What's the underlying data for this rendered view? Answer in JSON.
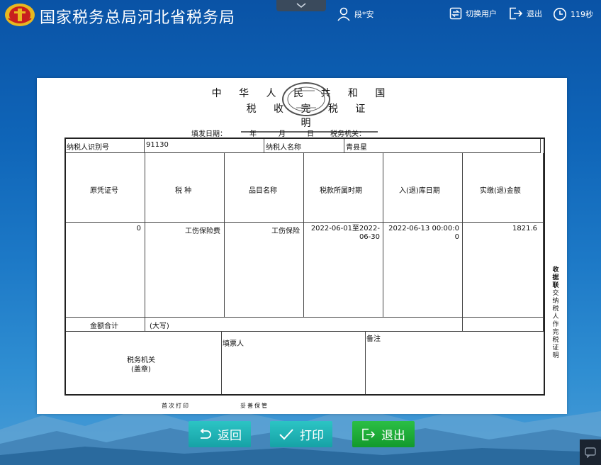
{
  "header": {
    "title": "国家税务总局河北省税务局",
    "user": "段*安",
    "switch_user": "切换用户",
    "logout": "退出",
    "countdown": "119秒"
  },
  "document": {
    "title_line1": "中 华 人 民 共 和 国",
    "title_line2": "税 收 完 税 证 明",
    "issue_date_label": "填发日期：",
    "year": "年",
    "month": "月",
    "day": "日",
    "tax_authority_label": "税务机关：",
    "taxpayer_id_label": "纳税人识别号",
    "taxpayer_id_value": "91130",
    "taxpayer_name_label": "纳税人名称",
    "taxpayer_name_value": "青县星",
    "columns": [
      "原凭证号",
      "税  种",
      "品目名称",
      "税款所属时期",
      "入(退)库日期",
      "实缴(退)金额"
    ],
    "rows": [
      {
        "voucher_no": "0",
        "tax_type": "工伤保险费",
        "item_name": "工伤保险",
        "period": "2022-06-01至2022-06-30",
        "warehouse_date": "2022-06-13 00:00:00",
        "amount": "1821.6"
      }
    ],
    "total_label": "金额合计",
    "total_caps": "(大写)",
    "authority_seal_label_1": "税务机关",
    "authority_seal_label_2": "(盖章)",
    "filler_label": "填票人",
    "remark_label": "备注",
    "side_title": "收据联",
    "side_text": "交纳税人作完税证明",
    "footer_left": "首次打印",
    "footer_right": "妥善保管"
  },
  "buttons": {
    "back": "返回",
    "print": "打印",
    "exit": "退出"
  }
}
